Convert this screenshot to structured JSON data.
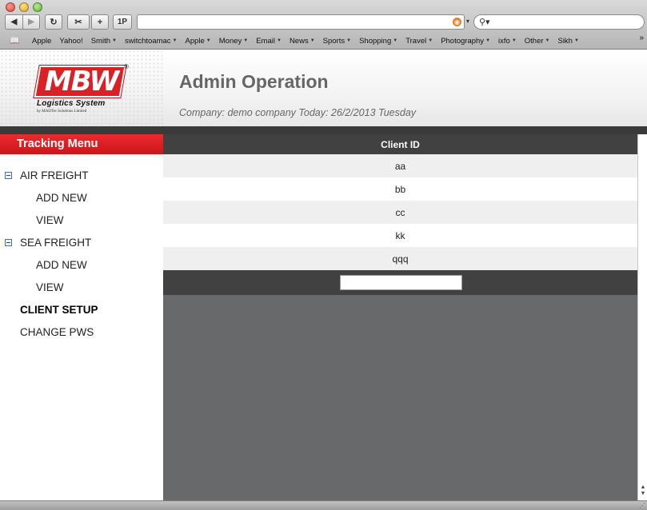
{
  "browser": {
    "url": "",
    "search_placeholder": "",
    "onepassword_label": "1P",
    "bookmarks": [
      {
        "label": "Apple",
        "menu": false
      },
      {
        "label": "Yahoo!",
        "menu": false
      },
      {
        "label": "Smith",
        "menu": true
      },
      {
        "label": "switchtoamac",
        "menu": true
      },
      {
        "label": "Apple",
        "menu": true
      },
      {
        "label": "Money",
        "menu": true
      },
      {
        "label": "Email",
        "menu": true
      },
      {
        "label": "News",
        "menu": true
      },
      {
        "label": "Sports",
        "menu": true
      },
      {
        "label": "Shopping",
        "menu": true
      },
      {
        "label": "Travel",
        "menu": true
      },
      {
        "label": "Photography",
        "menu": true
      },
      {
        "label": "ixfo",
        "menu": true
      },
      {
        "label": "Other",
        "menu": true
      },
      {
        "label": "Sikh",
        "menu": true
      }
    ]
  },
  "logo": {
    "mark": "MBW",
    "reg": "®",
    "subtitle": "Logistics System",
    "byline": "by MADTec Solutions Limited"
  },
  "header": {
    "title": "Admin Operation",
    "company_line": "Company: demo company Today: 26/2/2013 Tuesday"
  },
  "sidebar": {
    "title": "Tracking Menu",
    "items": [
      {
        "label": "AIR FREIGHT",
        "level": "top",
        "expanded": true
      },
      {
        "label": "ADD NEW",
        "level": "sub"
      },
      {
        "label": "VIEW",
        "level": "sub"
      },
      {
        "label": "SEA FREIGHT",
        "level": "top",
        "expanded": true
      },
      {
        "label": "ADD NEW",
        "level": "sub"
      },
      {
        "label": "VIEW",
        "level": "sub"
      },
      {
        "label": "CLIENT SETUP",
        "level": "top",
        "active": true
      },
      {
        "label": "CHANGE PWS",
        "level": "top"
      }
    ]
  },
  "table": {
    "column_header": "Client ID",
    "rows": [
      "aa",
      "bb",
      "cc",
      "kk",
      "qqq"
    ],
    "new_client_value": ""
  },
  "colors": {
    "menu_red": "#d92126",
    "table_header": "#414141",
    "content_bg": "#68696b"
  }
}
